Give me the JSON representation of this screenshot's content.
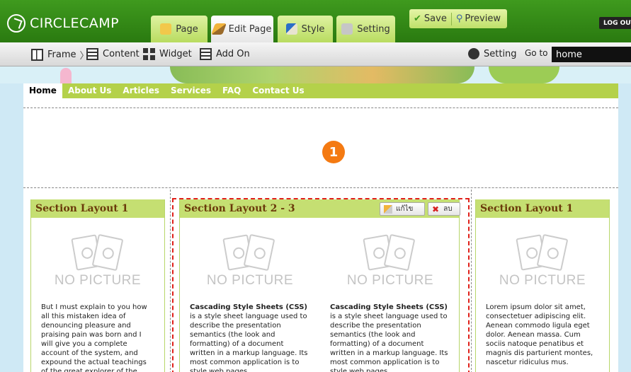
{
  "app": {
    "logo_text": "CIRCLECAMP"
  },
  "tabs": [
    {
      "label": "Page"
    },
    {
      "label": "Edit Page"
    },
    {
      "label": "Style"
    },
    {
      "label": "Setting"
    }
  ],
  "actions": {
    "save": "Save",
    "preview": "Preview",
    "logout": "LOG OUT"
  },
  "toolbar": {
    "frame": "Frame",
    "content": "Content",
    "widget": "Widget",
    "add_on": "Add On",
    "setting": "Setting",
    "goto_label": "Go to",
    "goto_value": "home"
  },
  "nav": [
    "Home",
    "About Us",
    "Articles",
    "Services",
    "FAQ",
    "Contact Us"
  ],
  "zone_badge": "1",
  "sections": {
    "left": {
      "title": "Section Layout 1",
      "picture_label": "NO PICTURE",
      "text": "But I must explain to you how all this mistaken idea of denouncing pleasure and praising pain was born and I will give you a complete account of the system, and expound the actual teachings of the great explorer of the truth,"
    },
    "middle": {
      "title": "Section Layout 2 - 3",
      "edit_label": "แก้ไข",
      "delete_label": "ลบ",
      "items": [
        {
          "picture_label": "NO PICTURE",
          "bold": "Cascading Style Sheets (CSS)",
          "text": " is a style sheet language used to describe the presentation semantics (the look and formatting) of a document written in a markup language. Its most common application is to style web pages"
        },
        {
          "picture_label": "NO PICTURE",
          "bold": "Cascading Style Sheets (CSS)",
          "text": " is a style sheet language used to describe the presentation semantics (the look and formatting) of a document written in a markup language. Its most common application is to style web pages"
        }
      ]
    },
    "right": {
      "title": "Section Layout 1",
      "picture_label": "NO PICTURE",
      "text": "Lorem ipsum dolor sit amet, consectetuer adipiscing elit. Aenean commodo ligula eget dolor. Aenean massa. Cum sociis natoque penatibus et magnis dis parturient montes, nascetur ridiculus mus."
    }
  },
  "colors": {
    "topbar": "#2a7a10",
    "nav": "#b4d14a",
    "section_header": "#c5df72",
    "badge": "#f47a12",
    "selection": "#e0201a"
  }
}
